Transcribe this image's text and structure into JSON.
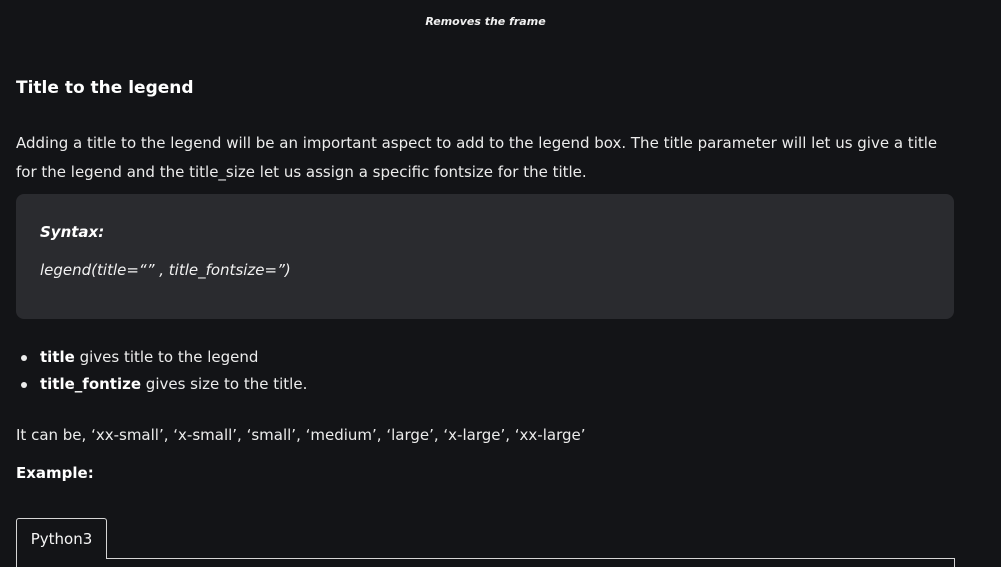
{
  "caption": "Removes the frame",
  "section_title": "Title to the legend",
  "paragraph": "Adding a title to the legend will be an important aspect to add to the legend box. The title parameter will let us give a title for the legend and the title_size let us assign a specific fontsize for the title.",
  "syntax": {
    "label": "Syntax:",
    "code": "legend(title=“” , title_fontsize=”)"
  },
  "bullets": [
    {
      "term": "title",
      "text": " gives title to the legend"
    },
    {
      "term": "title_fontize",
      "text": " gives size to the title."
    }
  ],
  "values_line": "It can be, ‘xx-small’, ‘x-small’, ‘small’, ‘medium’, ‘large’, ‘x-large’, ‘xx-large’",
  "example_label": "Example:",
  "code_tab": "Python3"
}
